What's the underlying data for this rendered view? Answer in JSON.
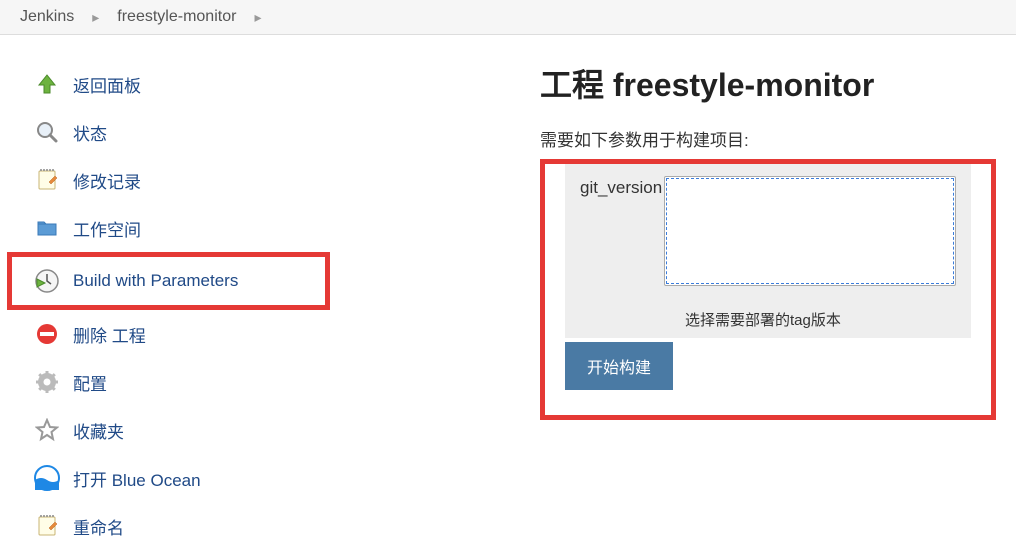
{
  "breadcrumb": {
    "items": [
      "Jenkins",
      "freestyle-monitor"
    ]
  },
  "sidebar": {
    "items": [
      {
        "label": "返回面板"
      },
      {
        "label": "状态"
      },
      {
        "label": "修改记录"
      },
      {
        "label": "工作空间"
      },
      {
        "label": "Build with Parameters"
      },
      {
        "label": "删除 工程"
      },
      {
        "label": "配置"
      },
      {
        "label": "收藏夹"
      },
      {
        "label": "打开 Blue Ocean"
      },
      {
        "label": "重命名"
      }
    ]
  },
  "content": {
    "title": "工程 freestyle-monitor",
    "subtitle": "需要如下参数用于构建项目:",
    "param_name": "git_version",
    "param_help": "选择需要部署的tag版本",
    "build_button": "开始构建"
  }
}
